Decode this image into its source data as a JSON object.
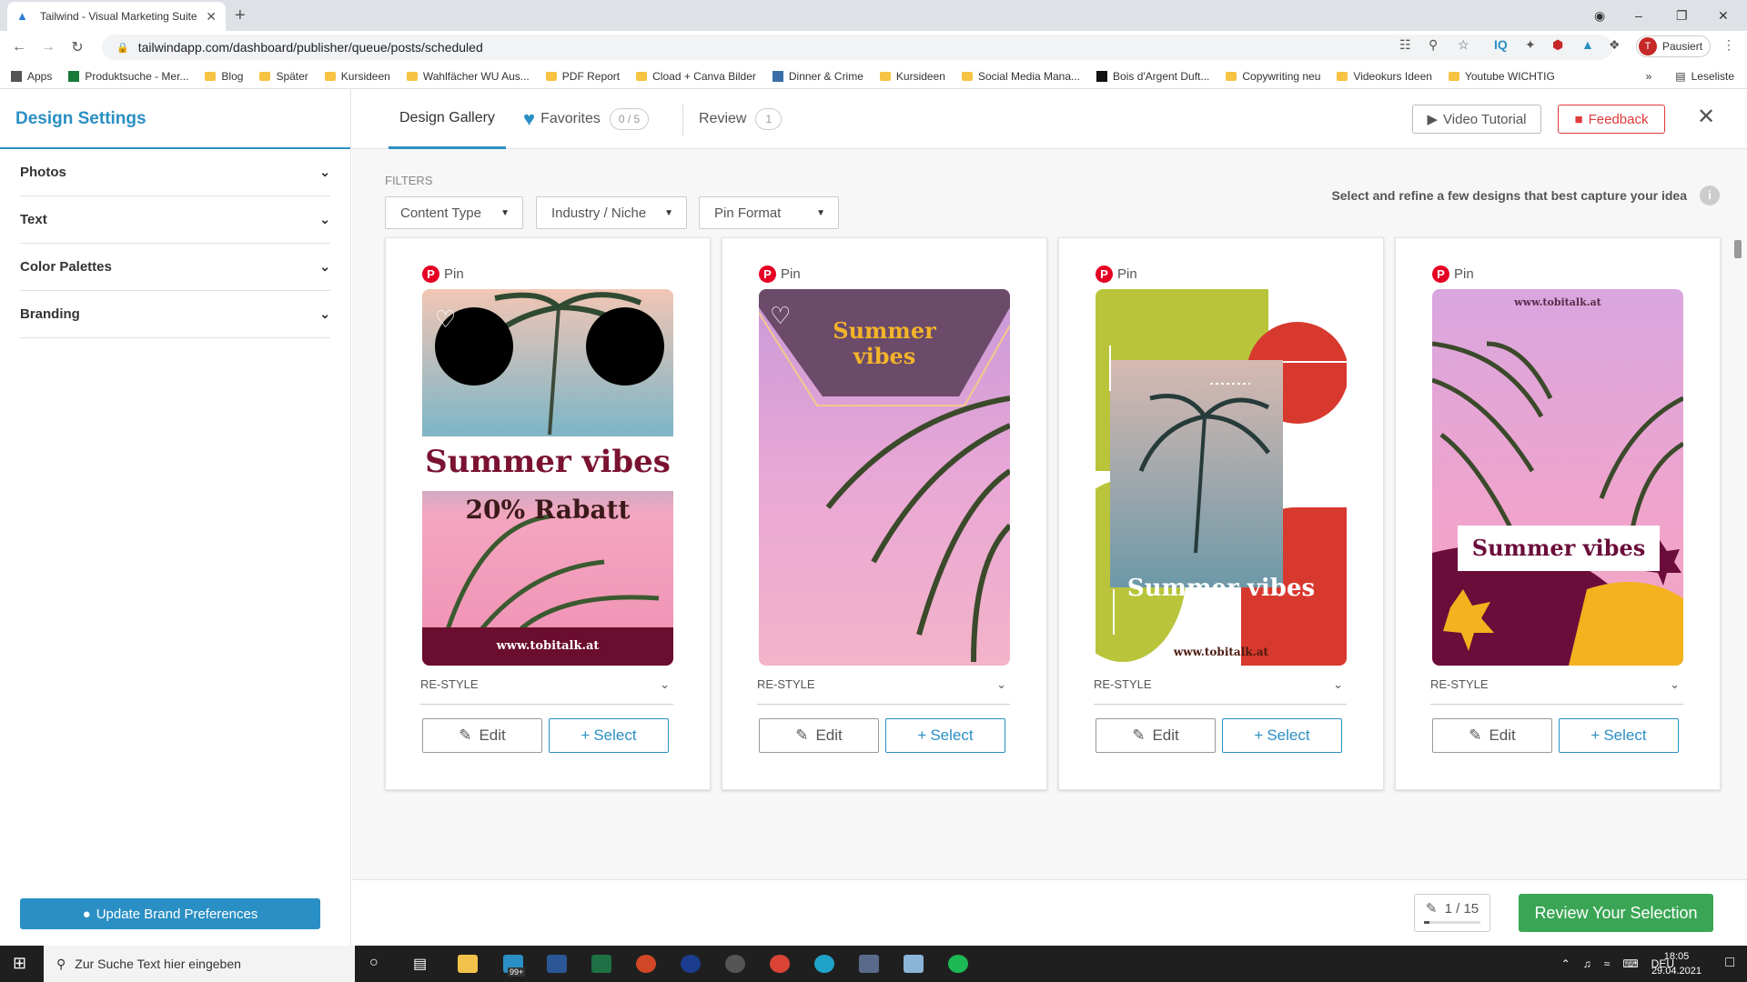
{
  "browser": {
    "tab_title": "Tailwind - Visual Marketing Suite",
    "url": "tailwindapp.com/dashboard/publisher/queue/posts/scheduled",
    "profile_label": "Pausiert",
    "profile_initial": "T",
    "bookmarks": [
      "Apps",
      "Produktsuche - Mer...",
      "Blog",
      "Später",
      "Kursideen",
      "Wahlfächer WU Aus...",
      "PDF Report",
      "Cload + Canva Bilder",
      "Dinner & Crime",
      "Kursideen",
      "Social Media Mana...",
      "Bois d'Argent Duft...",
      "Copywriting neu",
      "Videokurs Ideen",
      "Youtube WICHTIG"
    ],
    "reading_list": "Leseliste"
  },
  "sidebar": {
    "title": "Design Settings",
    "sections": [
      "Photos",
      "Text",
      "Color Palettes",
      "Branding"
    ],
    "update_button": "Update Brand Preferences"
  },
  "topnav": {
    "tabs": [
      {
        "label": "Design Gallery"
      },
      {
        "label": "Favorites",
        "badge": "0 / 5"
      },
      {
        "label": "Review",
        "badge": "1"
      }
    ],
    "video_tutorial": "Video Tutorial",
    "feedback": "Feedback"
  },
  "filters": {
    "label": "FILTERS",
    "dropdowns": [
      "Content Type",
      "Industry / Niche",
      "Pin Format"
    ],
    "hint": "Select and refine a few designs that best capture your idea"
  },
  "cards": [
    {
      "pin_label": "Pin",
      "headline": "Summer vibes",
      "subline": "20% Rabatt",
      "url": "www.tobitalk.at",
      "restyle": "RE-STYLE",
      "edit": "Edit",
      "select": "Select"
    },
    {
      "pin_label": "Pin",
      "headline": "Summer vibes",
      "subline": "",
      "url": "",
      "restyle": "RE-STYLE",
      "edit": "Edit",
      "select": "Select"
    },
    {
      "pin_label": "Pin",
      "headline": "Summer vibes",
      "subline": "",
      "url": "www.tobitalk.at",
      "restyle": "RE-STYLE",
      "edit": "Edit",
      "select": "Select"
    },
    {
      "pin_label": "Pin",
      "headline": "Summer vibes",
      "subline": "",
      "url": "www.tobitalk.at",
      "restyle": "RE-STYLE",
      "edit": "Edit",
      "select": "Select"
    }
  ],
  "footer": {
    "pager": "1 / 15",
    "review_button": "Review Your Selection"
  },
  "taskbar": {
    "search_placeholder": "Zur Suche Text hier eingeben",
    "badge": "99+",
    "lang": "DEU",
    "time": "18:05",
    "date": "29.04.2021"
  },
  "colors": {
    "accent": "#2a8fc4",
    "success": "#3aa655",
    "danger": "#e03a3a",
    "pinterest": "#e60023"
  }
}
